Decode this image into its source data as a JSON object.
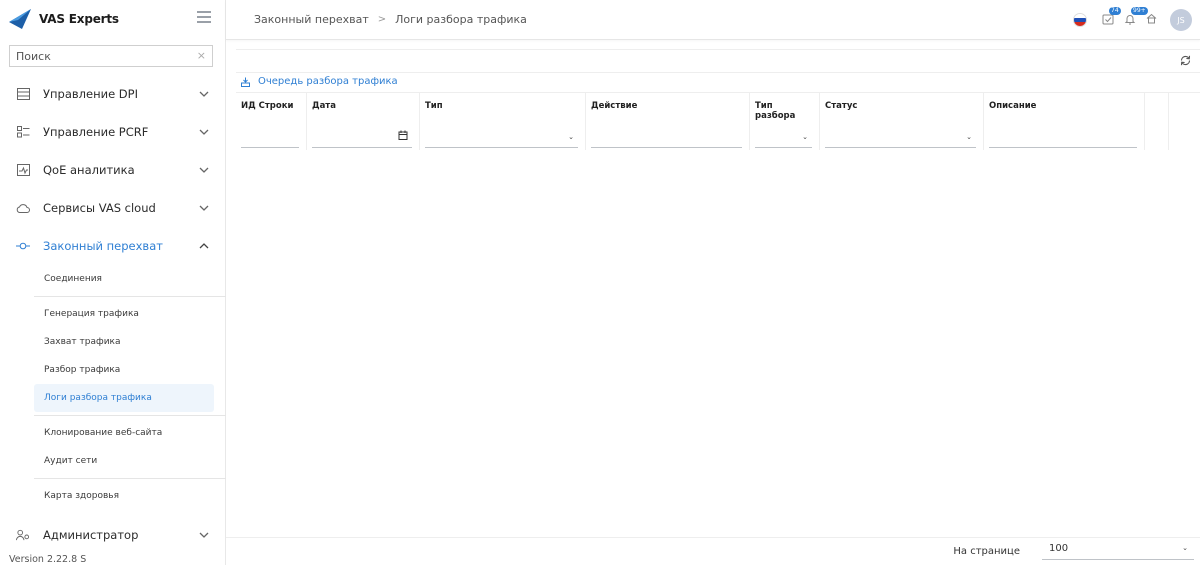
{
  "brand": {
    "name": "VAS Experts"
  },
  "search": {
    "placeholder": "Поиск",
    "clear": "×"
  },
  "menu": [
    {
      "label": "Управление DPI",
      "icon": "table-icon",
      "expanded": false
    },
    {
      "label": "Управление PCRF",
      "icon": "list-icon",
      "expanded": false
    },
    {
      "label": "QoE аналитика",
      "icon": "chart-icon",
      "expanded": false
    },
    {
      "label": "Сервисы VAS cloud",
      "icon": "cloud-icon",
      "expanded": false
    },
    {
      "label": "Законный перехват",
      "icon": "intercept-icon",
      "expanded": true,
      "active": true
    }
  ],
  "submenu": {
    "group1": [
      "Соединения"
    ],
    "group2": [
      "Генерация трафика",
      "Захват трафика",
      "Разбор трафика",
      "Логи разбора трафика"
    ],
    "group3": [
      "Клонирование веб-сайта",
      "Аудит сети"
    ],
    "group4": [
      "Карта здоровья"
    ],
    "active": "Логи разбора трафика"
  },
  "admin": {
    "label": "Администратор",
    "icon": "admin-icon"
  },
  "version": "Version 2.22.8 S",
  "breadcrumb": {
    "parent": "Законный перехват",
    "sep": ">",
    "current": "Логи разбора трафика"
  },
  "topbar": {
    "tasks_badge": "74",
    "notif_badge": "99+",
    "avatar": "JS"
  },
  "queue_link": "Очередь разбора трафика",
  "table": {
    "columns": [
      "ИД Строки",
      "Дата",
      "Тип",
      "Действие",
      "Тип разбора",
      "Статус",
      "Описание"
    ]
  },
  "footer": {
    "per_page_label": "На странице",
    "per_page_value": "100"
  },
  "colors": {
    "accent": "#2f7fd3",
    "active_bg": "#eef5fc"
  }
}
